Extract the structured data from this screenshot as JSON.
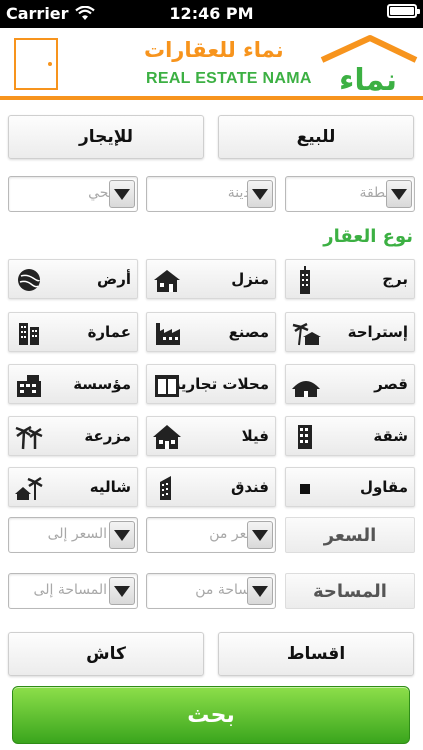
{
  "status_bar": {
    "carrier": "Carrier",
    "time": "12:46 PM",
    "battery_level": 1.0
  },
  "header": {
    "brand_ar": "نماء للعقارات",
    "brand_en": "REAL ESTATE NAMA",
    "logo_text": "نماء",
    "accent_color": "#f7941d",
    "green_color": "#3cb043"
  },
  "listing_type": {
    "sale_label": "للبيع",
    "rent_label": "للإيجار"
  },
  "location": {
    "region_placeholder": "المنطقة",
    "city_placeholder": "المدينة",
    "district_placeholder": "الحي"
  },
  "property_type": {
    "title": "نوع العقار",
    "items": [
      {
        "label": "برج",
        "icon": "tower-icon"
      },
      {
        "label": "منزل",
        "icon": "house-icon"
      },
      {
        "label": "أرض",
        "icon": "land-icon"
      },
      {
        "label": "إستراحة",
        "icon": "rest-house-icon"
      },
      {
        "label": "مصنع",
        "icon": "factory-icon"
      },
      {
        "label": "عمارة",
        "icon": "apartment-building-icon"
      },
      {
        "label": "قصر",
        "icon": "palace-icon"
      },
      {
        "label": "محلات تجارية",
        "icon": "shops-icon"
      },
      {
        "label": "مؤسسة",
        "icon": "establishment-icon"
      },
      {
        "label": "شقة",
        "icon": "flat-icon"
      },
      {
        "label": "فيلا",
        "icon": "villa-icon"
      },
      {
        "label": "مزرعة",
        "icon": "farm-icon"
      },
      {
        "label": "مقاول",
        "icon": "contractor-icon"
      },
      {
        "label": "فندق",
        "icon": "hotel-icon"
      },
      {
        "label": "شاليه",
        "icon": "chalet-icon"
      }
    ]
  },
  "price": {
    "label": "السعر",
    "from_placeholder": "السعر من",
    "to_placeholder": "السعر إلى"
  },
  "area": {
    "label": "المساحة",
    "from_placeholder": "المساحة من",
    "to_placeholder": "المساحة إلى"
  },
  "payment": {
    "installments_label": "اقساط",
    "cash_label": "كاش"
  },
  "search_label": "بحث"
}
